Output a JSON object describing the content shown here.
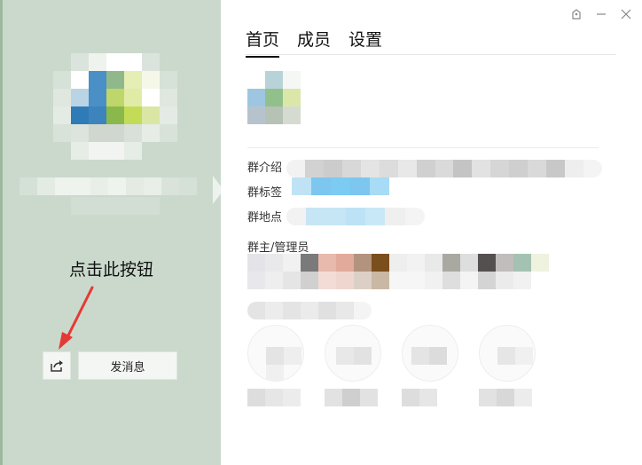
{
  "left_panel": {
    "avatar_icon": "blurred-group-avatar",
    "hint_text": "点击此按钮",
    "share_icon": "share-arrow-icon",
    "send_message_label": "发消息"
  },
  "window_controls": {
    "skin_icon": "skin-icon",
    "minimize_icon": "minimize-icon",
    "close_icon": "close-icon"
  },
  "tabs": [
    {
      "label": "首页",
      "active": true
    },
    {
      "label": "成员",
      "active": false
    },
    {
      "label": "设置",
      "active": false
    }
  ],
  "info": {
    "intro_label": "群介绍",
    "tags_label": "群标签",
    "location_label": "群地点",
    "admins_label": "群主/管理员"
  },
  "colors": {
    "left_bg": "#cad9cc",
    "accent_arrow": "#e53935"
  }
}
